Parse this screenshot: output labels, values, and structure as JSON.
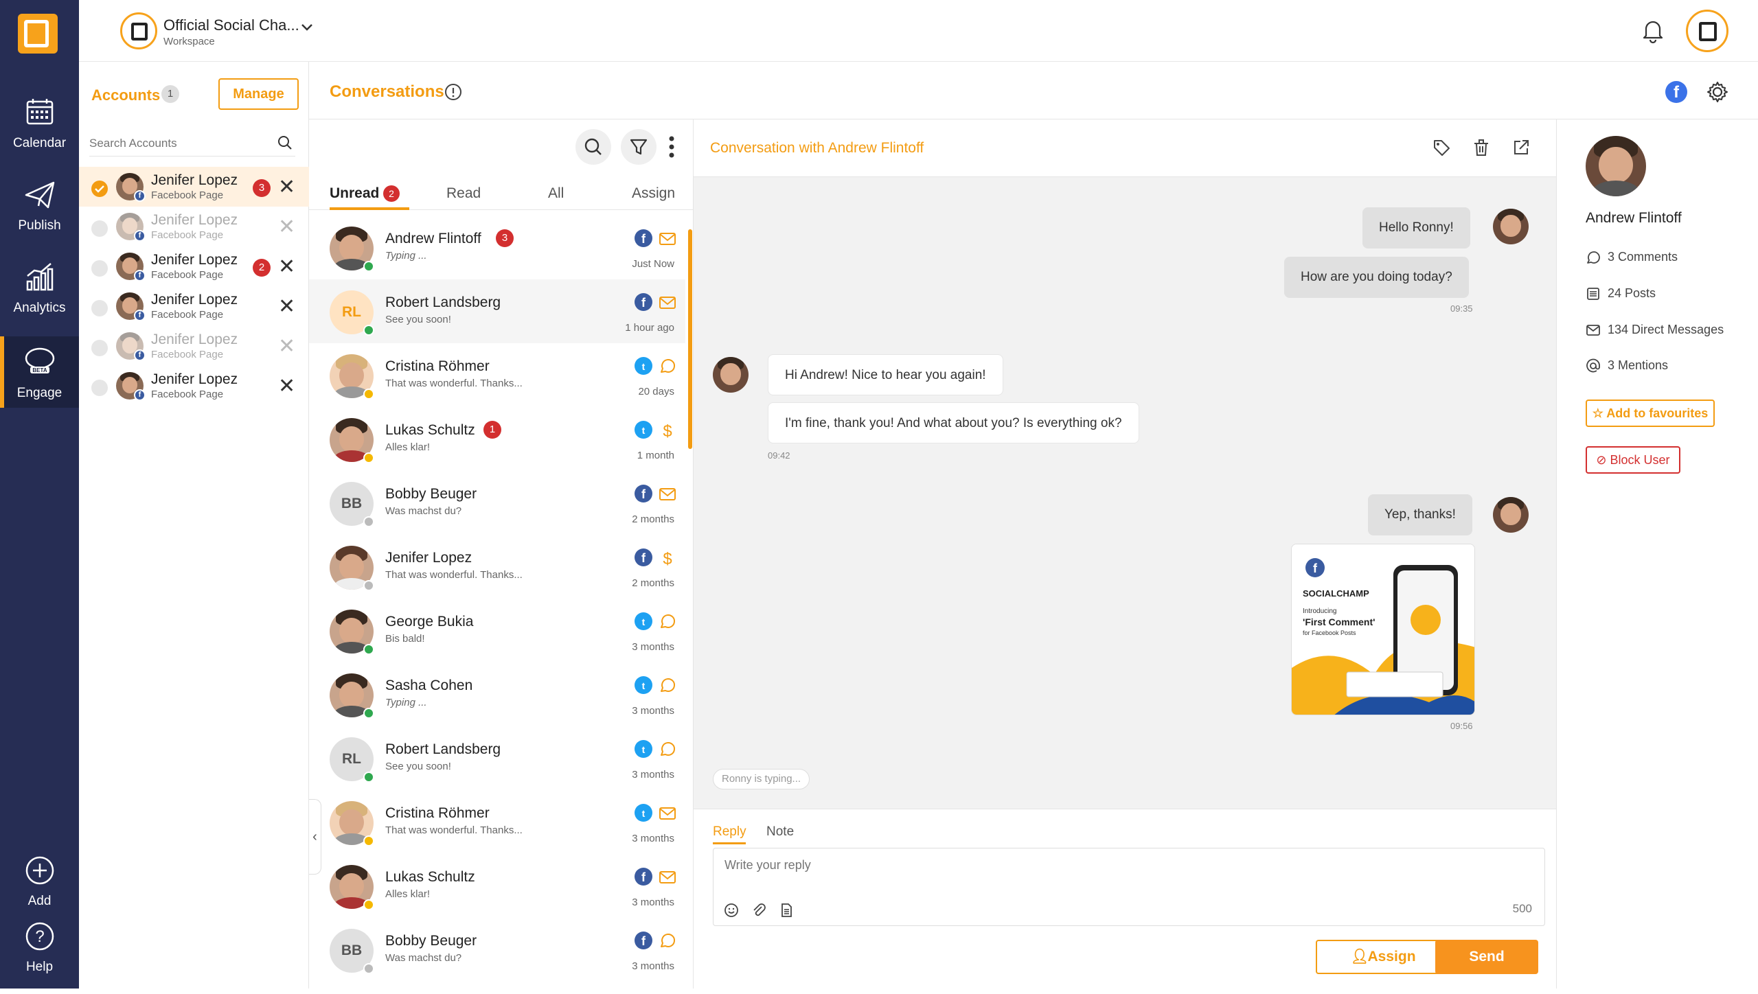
{
  "nav": {
    "items": [
      {
        "label": "Calendar",
        "icon": "calendar-icon"
      },
      {
        "label": "Publish",
        "icon": "paper-plane-icon"
      },
      {
        "label": "Analytics",
        "icon": "analytics-icon"
      },
      {
        "label": "Engage",
        "icon": "chat-bubbles-icon",
        "badge": "BETA"
      }
    ],
    "bottom": [
      {
        "label": "Add",
        "icon": "plus-circle-icon"
      },
      {
        "label": "Help",
        "icon": "question-circle-icon"
      }
    ]
  },
  "topbar": {
    "workspace_title": "Official Social Cha...",
    "workspace_sub": "Workspace"
  },
  "accounts": {
    "title": "Accounts",
    "count": "1",
    "manage_label": "Manage",
    "search_placeholder": "Search Accounts",
    "items": [
      {
        "name": "Jenifer Lopez",
        "type": "Facebook Page",
        "badge": "3"
      },
      {
        "name": "Jenifer Lopez",
        "type": "Facebook Page",
        "badge": ""
      },
      {
        "name": "Jenifer Lopez",
        "type": "Facebook Page",
        "badge": "2"
      },
      {
        "name": "Jenifer Lopez",
        "type": "Facebook Page",
        "badge": ""
      },
      {
        "name": "Jenifer Lopez",
        "type": "Facebook Page",
        "badge": ""
      },
      {
        "name": "Jenifer Lopez",
        "type": "Facebook Page",
        "badge": ""
      }
    ]
  },
  "conversations": {
    "title": "Conversations",
    "tabs": [
      {
        "label": "Unread",
        "badge": "2"
      },
      {
        "label": "Read"
      },
      {
        "label": "All"
      },
      {
        "label": "Assign"
      }
    ],
    "items": [
      {
        "name": "Andrew Flintoff",
        "preview": "Typing ...",
        "time": "Just Now",
        "badge": "3"
      },
      {
        "name": "Robert Landsberg",
        "initials": "RL",
        "preview": "See you soon!",
        "time": "1 hour ago"
      },
      {
        "name": "Cristina Röhmer",
        "preview": "That was wonderful. Thanks...",
        "time": "20 days"
      },
      {
        "name": "Lukas Schultz",
        "preview": "Alles klar!",
        "time": "1 month",
        "badge": "1"
      },
      {
        "name": "Bobby Beuger",
        "initials": "BB",
        "preview": "Was machst du?",
        "time": "2 months"
      },
      {
        "name": "Jenifer Lopez",
        "preview": "That was wonderful. Thanks...",
        "time": "2 months"
      },
      {
        "name": "George Bukia",
        "preview": "Bis bald!",
        "time": "3 months"
      },
      {
        "name": "Sasha Cohen",
        "preview": "Typing ...",
        "time": "3 months"
      },
      {
        "name": "Robert Landsberg",
        "initials": "RL",
        "preview": "See you soon!",
        "time": "3 months"
      },
      {
        "name": "Cristina Röhmer",
        "preview": "That was wonderful. Thanks...",
        "time": "3 months"
      },
      {
        "name": "Lukas Schultz",
        "preview": "Alles klar!",
        "time": "3 months"
      },
      {
        "name": "Bobby Beuger",
        "initials": "BB",
        "preview": "Was machst du?",
        "time": "3 months"
      }
    ]
  },
  "chat": {
    "title": "Conversation with Andrew Flintoff",
    "messages": [
      {
        "text": "Hello Ronny!"
      },
      {
        "text": "How are you doing today?",
        "time": "09:35"
      },
      {
        "text": "Hi Andrew! Nice to hear you again!"
      },
      {
        "text": "I'm fine, thank you! And what about you? Is everything ok?",
        "time": "09:42"
      },
      {
        "text": "Yep, thanks!"
      },
      {
        "time": "09:56"
      }
    ],
    "attachment": {
      "brand": "SOCIALCHAMP",
      "line1": "Introducing",
      "line2": "'First Comment'",
      "line3": "for Facebook Posts"
    },
    "typing": "Ronny is typing..."
  },
  "reply": {
    "tab_reply": "Reply",
    "tab_note": "Note",
    "placeholder": "Write your reply",
    "char_count": "500",
    "assign_label": "Assign",
    "send_label": "Send"
  },
  "profile": {
    "name": "Andrew Flintoff",
    "stats": [
      {
        "label": "3 Comments"
      },
      {
        "label": "24 Posts"
      },
      {
        "label": "134 Direct Messages"
      },
      {
        "label": "3 Mentions"
      }
    ],
    "fav_label": "Add to favourites",
    "block_label": "Block User"
  }
}
